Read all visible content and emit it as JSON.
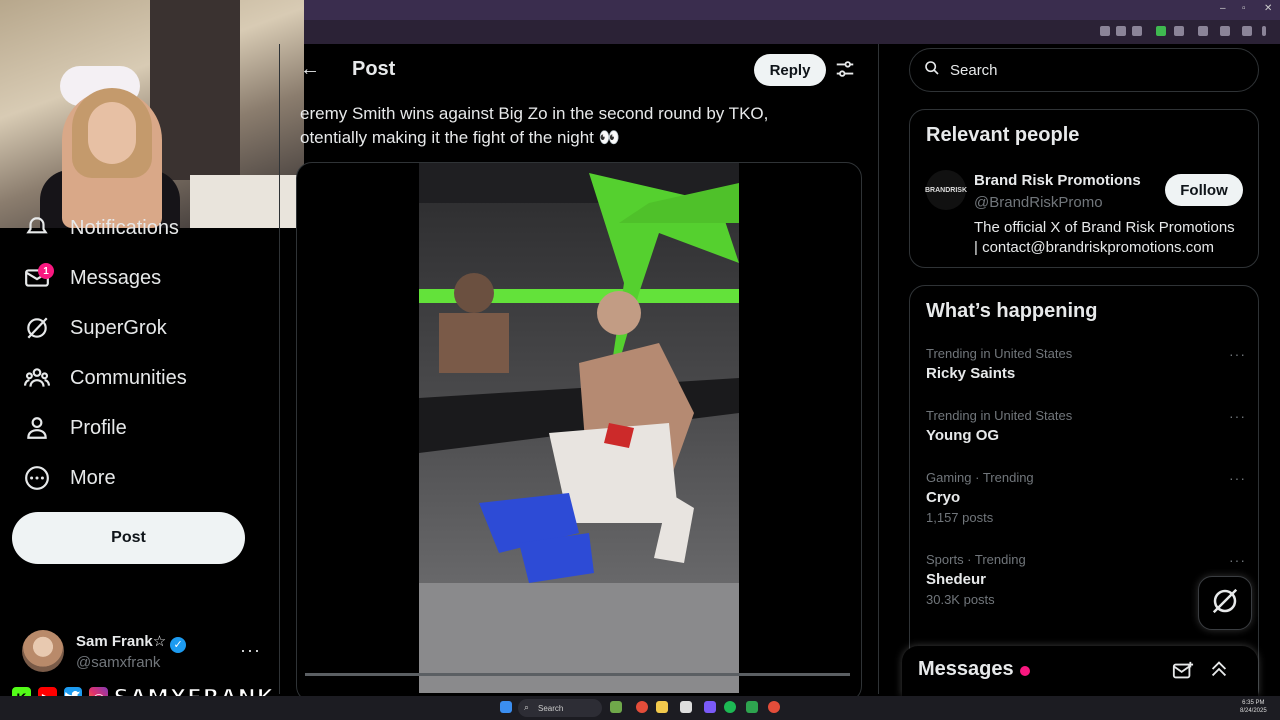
{
  "nav": {
    "items": [
      {
        "label": "Notifications",
        "icon": "bell-icon"
      },
      {
        "label": "Messages",
        "icon": "mail-icon",
        "badge": "1"
      },
      {
        "label": "SuperGrok",
        "icon": "grok-icon"
      },
      {
        "label": "Communities",
        "icon": "communities-icon"
      },
      {
        "label": "Profile",
        "icon": "person-icon"
      },
      {
        "label": "More",
        "icon": "more-circle-icon"
      }
    ],
    "post_button": "Post"
  },
  "account": {
    "name": "Sam Frank☆",
    "handle": "@samxfrank",
    "more": "···"
  },
  "stream_banner": {
    "text": "SAMXFRANK",
    "icons": [
      "kick-icon",
      "youtube-icon",
      "twitter-icon",
      "instagram-icon"
    ],
    "kick_letter": "K"
  },
  "post": {
    "header_title": "Post",
    "reply_button": "Reply",
    "text_line1": "eremy Smith wins against Big Zo in the second round by TKO,",
    "text_line2": "otentially making it the fight of the night 👀"
  },
  "search": {
    "label": "Search"
  },
  "relevant_people": {
    "title": "Relevant people",
    "name": "Brand Risk Promotions",
    "handle": "@BrandRiskPromo",
    "bio_line1": "The official X of Brand Risk Promotions",
    "bio_line2": "| contact@brandriskpromotions.com",
    "follow_button": "Follow",
    "avatar_text": "BRANDRISK"
  },
  "whats_happening": {
    "title": "What’s happening",
    "trends": [
      {
        "meta": "Trending in United States",
        "name": "Ricky Saints",
        "count": ""
      },
      {
        "meta": "Trending in United States",
        "name": "Young OG",
        "count": ""
      },
      {
        "meta": "Gaming · Trending",
        "name": "Cryo",
        "count": "1,157 posts"
      },
      {
        "meta": "Sports · Trending",
        "name": "Shedeur",
        "count": "30.3K posts"
      }
    ],
    "dots": "···"
  },
  "messages_drawer": {
    "title": "Messages"
  },
  "taskbar": {
    "search_label": "Search",
    "time": "6:35 PM",
    "date": "8/24/2025"
  },
  "colors": {
    "accent_blue": "#1d9bf0",
    "pink": "#f91880",
    "background": "#000000",
    "border": "#2f3336",
    "muted_text": "#71767b"
  },
  "video": {
    "progress": 0.0
  }
}
